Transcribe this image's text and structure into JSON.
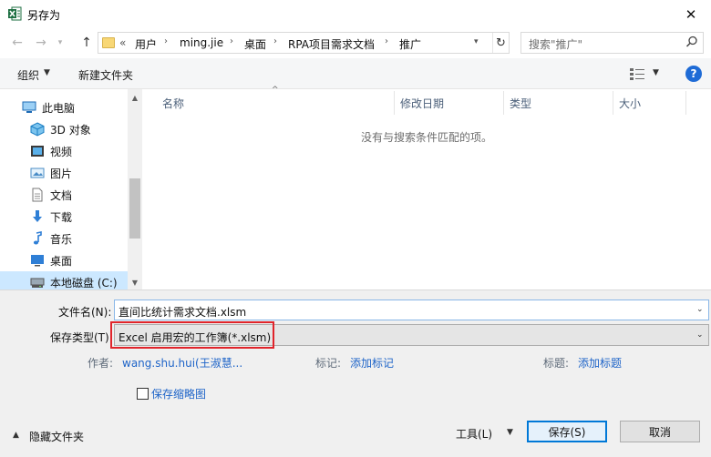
{
  "window": {
    "title": "另存为",
    "close_glyph": "✕"
  },
  "address": {
    "more": "«",
    "crumbs": [
      "用户",
      "ming.jie",
      "桌面",
      "RPA项目需求文档",
      "推广"
    ],
    "sep": "›",
    "search_placeholder": "搜索\"推广\""
  },
  "toolbar": {
    "organize": "组织",
    "new_folder": "新建文件夹",
    "help": "?"
  },
  "nav": {
    "items": [
      {
        "label": "此电脑",
        "icon": "computer-icon"
      },
      {
        "label": "3D 对象",
        "icon": "cube-3d-icon"
      },
      {
        "label": "视频",
        "icon": "video-icon"
      },
      {
        "label": "图片",
        "icon": "picture-icon"
      },
      {
        "label": "文档",
        "icon": "document-icon"
      },
      {
        "label": "下载",
        "icon": "download-icon"
      },
      {
        "label": "音乐",
        "icon": "music-icon"
      },
      {
        "label": "桌面",
        "icon": "desktop-icon"
      },
      {
        "label": "本地磁盘 (C:)",
        "icon": "drive-icon"
      }
    ]
  },
  "filelist": {
    "columns": [
      "名称",
      "修改日期",
      "类型",
      "大小"
    ],
    "empty_message": "没有与搜索条件匹配的项。"
  },
  "form": {
    "filename_label": "文件名(N):",
    "filename_value": "直间比统计需求文档.xlsm",
    "type_label": "保存类型(T):",
    "type_value": "Excel 启用宏的工作簿(*.xlsm)",
    "author_label": "作者:",
    "author_value": "wang.shu.hui(王淑慧...",
    "tags_label": "标记:",
    "tags_value": "添加标记",
    "title_label": "标题:",
    "title_value": "添加标题",
    "thumbnail_label": "保存缩略图"
  },
  "footer": {
    "hide_folders": "隐藏文件夹",
    "tools": "工具(L)",
    "save": "保存(S)",
    "cancel": "取消"
  },
  "colors": {
    "accent": "#0078d7",
    "link": "#1e64c8",
    "highlight_box": "#e0242b",
    "selection": "#cce8ff"
  }
}
